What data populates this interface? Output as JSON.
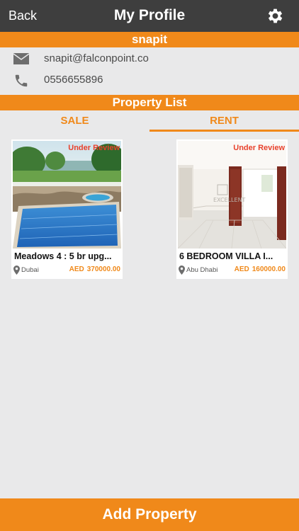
{
  "nav": {
    "back_label": "Back",
    "title": "My Profile",
    "settings_icon": "gear-icon"
  },
  "user": {
    "username": "snapit",
    "email": "snapit@falconpoint.co",
    "phone": "0556655896",
    "email_icon": "envelope-icon",
    "phone_icon": "phone-icon"
  },
  "property_list": {
    "heading": "Property List",
    "tabs": [
      {
        "label": "SALE",
        "active": false
      },
      {
        "label": "RENT",
        "active": true
      }
    ],
    "items": [
      {
        "status": "Under Review",
        "title": "Meadows 4 : 5 br upg...",
        "location": "Dubai",
        "currency": "AED",
        "price": "370000.00",
        "image": "villa-pool-photo"
      },
      {
        "status": "Under Review",
        "title": "6 BEDROOM VILLA I...",
        "location": "Abu Dhabi",
        "currency": "AED",
        "price": "160000.00",
        "image": "empty-room-photo"
      }
    ]
  },
  "footer": {
    "add_label": "Add Property"
  },
  "colors": {
    "accent": "#f0891a",
    "navbar": "#3e3e3e",
    "status": "#e8412c",
    "background": "#e9e9ea"
  }
}
